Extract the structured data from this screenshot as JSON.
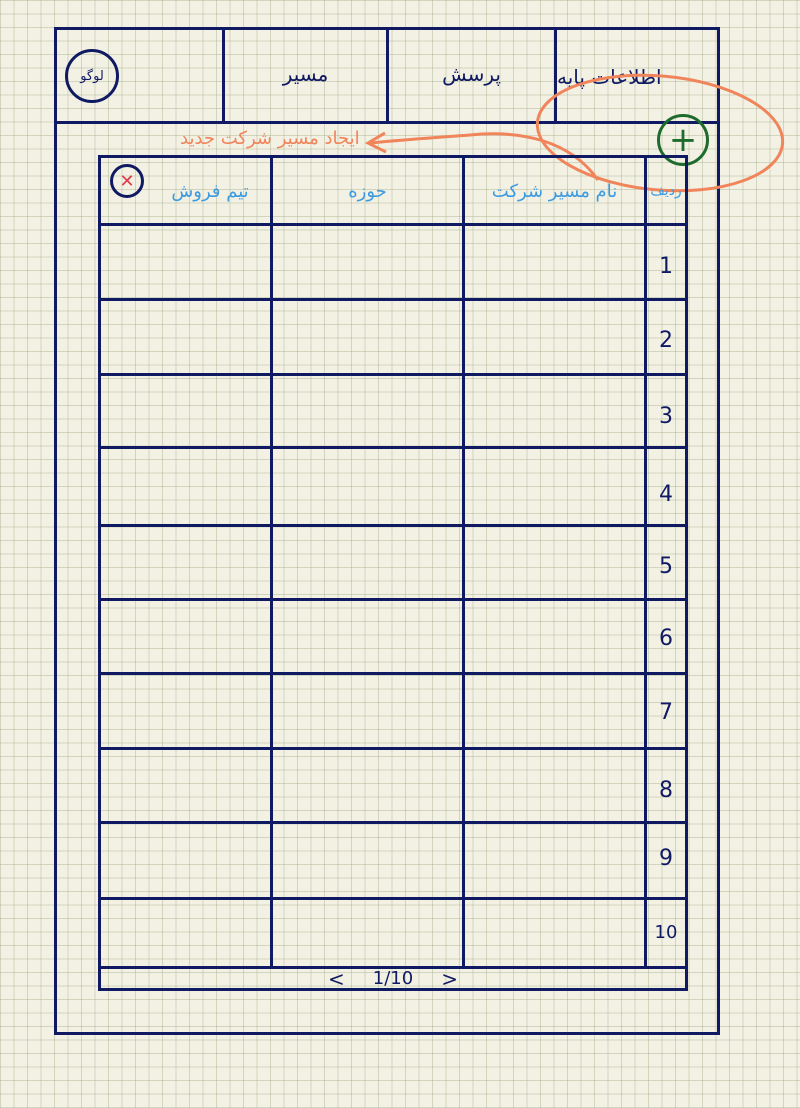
{
  "header": {
    "logo_label": "لوگو",
    "menu": [
      {
        "label": "مسیر"
      },
      {
        "label": "پرسش"
      },
      {
        "label": "اطلاعات پایه"
      }
    ]
  },
  "annotation": {
    "text": "ایجاد مسیر شرکت جدید",
    "color": "#f0845a"
  },
  "add_button": {
    "icon": "plus-icon",
    "color": "#1e6b2e"
  },
  "table": {
    "columns": [
      {
        "label": "تیم فروش"
      },
      {
        "label": "حوزه"
      },
      {
        "label": "نام مسیر شرکت"
      },
      {
        "label": "ردیف"
      }
    ],
    "rows": [
      "1",
      "2",
      "3",
      "4",
      "5",
      "6",
      "7",
      "8",
      "9",
      "10"
    ],
    "delete_icon": "close-icon"
  },
  "pagination": {
    "prev": "<",
    "page": "1/10",
    "next": ">"
  },
  "colors": {
    "ink": "#101a63",
    "header_text_blue": "#3d9be0",
    "accent_orange": "#f0845a",
    "add_green": "#1e6b2e",
    "delete_red": "#e03a4a"
  }
}
